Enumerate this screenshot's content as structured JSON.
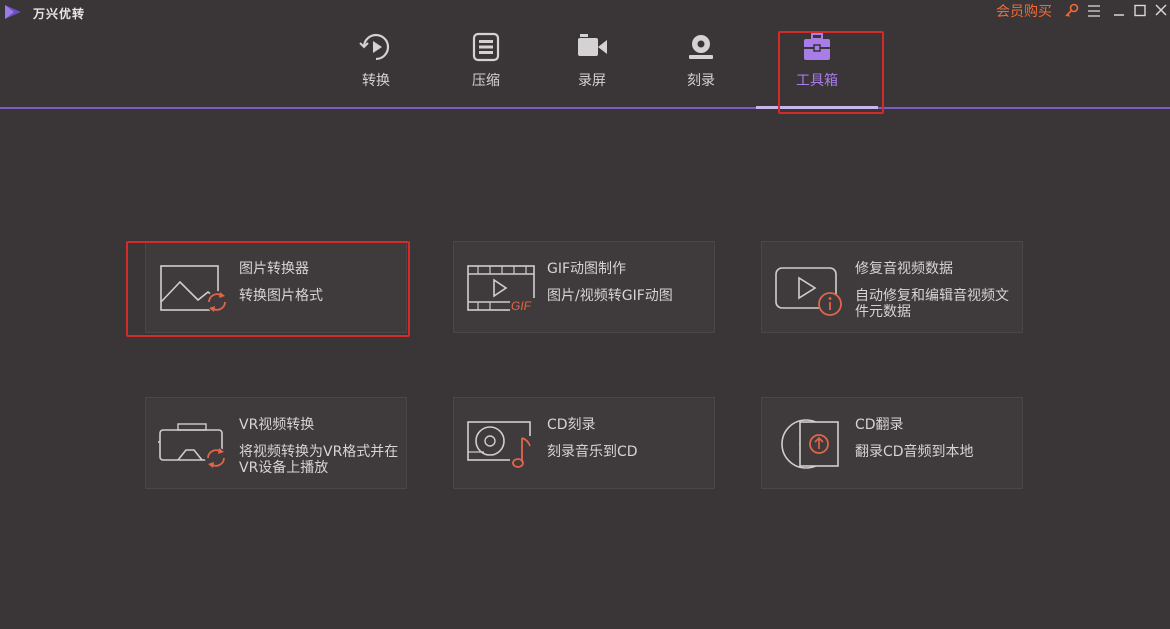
{
  "app": {
    "name": "万兴优转",
    "vip_label": "会员购买"
  },
  "nav": {
    "items": [
      {
        "label": "转换",
        "icon": "convert-icon"
      },
      {
        "label": "压缩",
        "icon": "compress-icon"
      },
      {
        "label": "录屏",
        "icon": "record-screen-icon"
      },
      {
        "label": "刻录",
        "icon": "burn-icon"
      },
      {
        "label": "工具箱",
        "icon": "toolbox-icon",
        "active": true
      }
    ]
  },
  "tools": [
    {
      "title": "图片转换器",
      "desc": "转换图片格式",
      "icon": "image-convert-icon"
    },
    {
      "title": "GIF动图制作",
      "desc": "图片/视频转GIF动图",
      "icon": "gif-maker-icon"
    },
    {
      "title": "修复音视频数据",
      "desc": "自动修复和编辑音视频文件元数据",
      "icon": "metadata-fix-icon"
    },
    {
      "title": "VR视频转换",
      "desc": "将视频转换为VR格式并在VR设备上播放",
      "icon": "vr-convert-icon"
    },
    {
      "title": "CD刻录",
      "desc": "刻录音乐到CD",
      "icon": "cd-burn-icon"
    },
    {
      "title": "CD翻录",
      "desc": "翻录CD音频到本地",
      "icon": "cd-rip-icon"
    }
  ],
  "colors": {
    "background": "#3a3536",
    "accent": "#a87de8",
    "icon_orange": "#e2654a",
    "highlight": "#d42a2a"
  }
}
